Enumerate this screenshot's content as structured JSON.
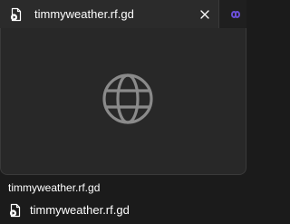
{
  "tab": {
    "title": "timmyweather.rf.gd",
    "favicon": "document-play-icon",
    "close": "close-icon",
    "next_tab_icon": "infinity-icon"
  },
  "preview": {
    "placeholder_icon": "globe-icon"
  },
  "hover_card": {
    "url": "timmyweather.rf.gd",
    "title": "timmyweather.rf.gd",
    "favicon": "document-play-icon"
  },
  "colors": {
    "background": "#1b1b1b",
    "tab_active": "#2b2b2b",
    "preview_bg": "#282828",
    "text": "#ffffff",
    "icon_gray": "#8a8a8a",
    "accent_purple": "#6b4fd8"
  }
}
